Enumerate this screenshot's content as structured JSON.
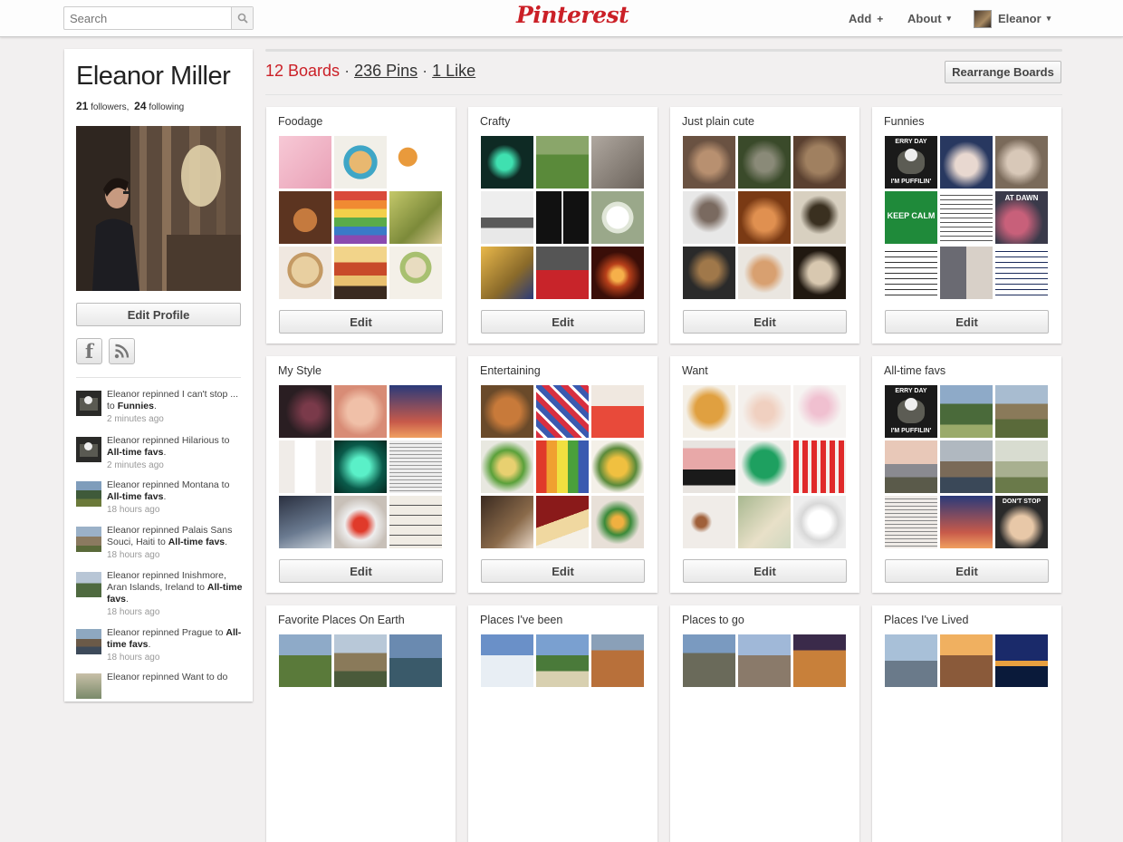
{
  "header": {
    "search_placeholder": "Search",
    "logo": "Pinterest",
    "add_label": "Add",
    "add_symbol": "+",
    "about_label": "About",
    "user_label": "Eleanor",
    "caret": "▾"
  },
  "profile": {
    "name": "Eleanor Miller",
    "followers_count": "21",
    "followers_label": "followers,",
    "following_count": "24",
    "following_label": "following",
    "edit_profile_label": "Edit Profile",
    "facebook_glyph": "f"
  },
  "activity": [
    {
      "text": "Eleanor repinned I can't stop ... to",
      "board": "Funnies",
      "suffix": ".",
      "time": "2 minutes ago"
    },
    {
      "text": "Eleanor repinned Hilarious to",
      "board": "All-time favs",
      "suffix": ".",
      "time": "2 minutes ago"
    },
    {
      "text": "Eleanor repinned Montana to",
      "board": "All-time favs",
      "suffix": ".",
      "time": "18 hours ago"
    },
    {
      "text": "Eleanor repinned Palais Sans Souci, Haiti to",
      "board": "All-time favs",
      "suffix": ".",
      "time": "18 hours ago"
    },
    {
      "text": "Eleanor repinned Inishmore, Aran Islands, Ireland to",
      "board": "All-time favs",
      "suffix": ".",
      "time": "18 hours ago"
    },
    {
      "text": "Eleanor repinned Prague to",
      "board": "All-time favs",
      "suffix": ".",
      "time": "18 hours ago"
    },
    {
      "text": "Eleanor repinned Want to do",
      "board": "",
      "suffix": "",
      "time": ""
    }
  ],
  "stats": {
    "boards": "12 Boards",
    "sep1": " · ",
    "pins": "236 Pins",
    "sep2": " · ",
    "likes": "1 Like"
  },
  "rearrange_label": "Rearrange Boards",
  "edit_label": "Edit",
  "boards": [
    {
      "title": "Foodage"
    },
    {
      "title": "Crafty"
    },
    {
      "title": "Just plain cute"
    },
    {
      "title": "Funnies"
    },
    {
      "title": "My Style"
    },
    {
      "title": "Entertaining"
    },
    {
      "title": "Want"
    },
    {
      "title": "All-time favs"
    },
    {
      "title": "Favorite Places On Earth"
    },
    {
      "title": "Places I've been"
    },
    {
      "title": "Places to go"
    },
    {
      "title": "Places I've Lived"
    }
  ],
  "pin_captions": {
    "puffin_top": "ERRY DAY",
    "puffin_bottom": "I'M PUFFILIN'",
    "keep_calm": "KEEP CALM",
    "at_dawn": "AT DAWN",
    "dont_stop": "DON'T STOP"
  },
  "colors": {
    "brand_red": "#cb2027",
    "page_bg": "#f2f0f0"
  }
}
